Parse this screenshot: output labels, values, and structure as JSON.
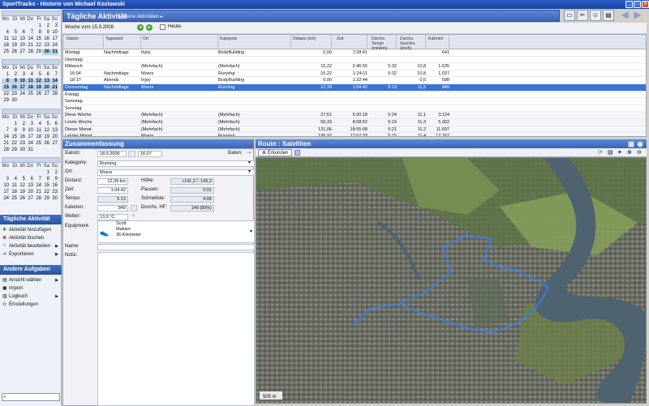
{
  "window": {
    "title": "SportTracks - Historie von Michael Kozlowski"
  },
  "calendar": {
    "weekdays": [
      "Mo",
      "Di",
      "Mi",
      "Do",
      "Fr",
      "Sa",
      "So"
    ],
    "months": [
      {
        "days": [
          "",
          "",
          "",
          "",
          "1",
          "2",
          "3",
          "4",
          "5",
          "6",
          "7",
          "8",
          "9",
          "10",
          "11",
          "12",
          "13",
          "14",
          "15",
          "16",
          "17",
          "18",
          "19",
          "20",
          "21",
          "22",
          "23",
          "24",
          "25",
          "26",
          "27",
          "28",
          "29",
          "30",
          "31"
        ]
      },
      {
        "days": [
          "1",
          "2",
          "3",
          "4",
          "5",
          "6",
          "7",
          "8",
          "9",
          "10",
          "11",
          "12",
          "13",
          "14",
          "15",
          "16",
          "17",
          "18",
          "19",
          "20",
          "21",
          "22",
          "23",
          "24",
          "25",
          "26",
          "27",
          "28",
          "29",
          "30"
        ]
      },
      {
        "days": [
          "",
          "1",
          "2",
          "3",
          "4",
          "5",
          "6",
          "7",
          "8",
          "9",
          "10",
          "11",
          "12",
          "13",
          "14",
          "15",
          "16",
          "17",
          "18",
          "19",
          "20",
          "21",
          "22",
          "23",
          "24",
          "25",
          "26",
          "27",
          "28",
          "29",
          "30",
          "31"
        ]
      },
      {
        "days": [
          "",
          "",
          "",
          "",
          "",
          "1",
          "2",
          "3",
          "4",
          "5",
          "6",
          "7",
          "8",
          "9",
          "10",
          "11",
          "12",
          "13",
          "14",
          "15",
          "16",
          "17",
          "18",
          "19",
          "20",
          "21",
          "22",
          "23",
          "24",
          "25",
          "26",
          "27",
          "28",
          "29",
          "30"
        ]
      }
    ]
  },
  "left_tasks": {
    "title": "Tägliche Aktivität",
    "items": [
      "Aktivität hinzufügen",
      "Aktivität löschen",
      "Aktivität bearbeiten",
      "Exportieren"
    ]
  },
  "left_other": {
    "title": "Andere Aufgaben",
    "items": [
      "Ansicht wählen",
      "Import",
      "Logbuch",
      "Einstellungen"
    ]
  },
  "header": {
    "title": "Tägliche Aktivität",
    "crumb": "Meine Aktivitäten"
  },
  "week": {
    "label": "Woche vom 15.9.2008",
    "today": "Heute"
  },
  "table": {
    "columns": [
      "Datum",
      "Tageszeit",
      "Ort",
      "Kategorie",
      "Distanz (km)",
      "Zeit",
      "Durchs. Tempo (min/km)",
      "Durchs. Geschw. (km/h)",
      "Kalorien"
    ],
    "rows": [
      {
        "c": [
          "Montag",
          "Nachmittags",
          "Injoy",
          "BodyBuilding",
          "0,00",
          "1:28:41",
          "",
          "",
          "641"
        ]
      },
      {
        "c": [
          "Dienstag",
          "",
          "",
          "",
          "",
          "",
          "",
          "",
          ""
        ]
      },
      {
        "c": [
          "Mittwoch",
          "",
          "(Mehrfach)",
          "(Mehrfach)",
          "15,22",
          "2:46:55",
          "5:32",
          "10,8",
          "1.635"
        ]
      },
      {
        "c": [
          "16:04",
          "Nachmittags",
          "Moers",
          "Running",
          "15,22",
          "1:24:11",
          "5:32",
          "10,8",
          "1.037"
        ]
      },
      {
        "c": [
          "18:17",
          "Abends",
          "Injoy",
          "BodyBuilding",
          "0,00",
          "1:22:44",
          "",
          "0,0",
          "598"
        ]
      },
      {
        "c": [
          "Donnerstag",
          "Nachmittags",
          "Moers",
          "Running",
          "12,39",
          "1:04:42",
          "5:13",
          "11,5",
          "849"
        ],
        "sel": true
      },
      {
        "c": [
          "Freitag",
          "",
          "",
          "",
          "",
          "",
          "",
          "",
          ""
        ]
      },
      {
        "c": [
          "Samstag",
          "",
          "",
          "",
          "",
          "",
          "",
          "",
          ""
        ]
      },
      {
        "c": [
          "Sonntag",
          "",
          "",
          "",
          "",
          "",
          "",
          "",
          ""
        ]
      },
      {
        "c": [
          "Diese Woche",
          "",
          "(Mehrfach)",
          "(Mehrfach)",
          "27,61",
          "5:20:18",
          "5:24",
          "11,1",
          "3.124"
        ],
        "sum": true
      },
      {
        "c": [
          "Letzte Woche",
          "",
          "(Mehrfach)",
          "(Mehrfach)",
          "59,33",
          "8:08:52",
          "5:19",
          "11,3",
          "5.302"
        ],
        "sum": true
      },
      {
        "c": [
          "Dieser Monat",
          "",
          "(Mehrfach)",
          "(Mehrfach)",
          "131,06",
          "18:55:08",
          "5:21",
          "11,2",
          "11.697"
        ],
        "sum": true
      },
      {
        "c": [
          "Letzter Monat",
          "",
          "Moers",
          "Running",
          "195,92",
          "17:07:33",
          "5:15",
          "11,4",
          "12.767"
        ],
        "sum": true
      }
    ]
  },
  "summary": {
    "title": "Zusammenfassung",
    "datum_label": "Datum:",
    "datum": "18.9.2008",
    "time": "16:07",
    "daten_label": "Daten:",
    "kategorie_label": "Kategorie:",
    "kategorie": "Running",
    "ort_label": "Ort:",
    "ort": "Moers",
    "distanz_label": "Distanz:",
    "distanz": "12,39 km",
    "hoehe_label": "Höhe:",
    "hoehe": "+141,2 / -145,2",
    "zeit_label": "Zeit:",
    "zeit": "1:04:42",
    "pausen_label": "Pausen:",
    "pausen": "0:01",
    "tempo_label": "Tempo:",
    "tempo": "5:13",
    "schnell_label": "Schnellste:",
    "schnell": "4:08",
    "kalorien_label": "Kalorien:",
    "kalorien": "849",
    "hf_label": "Durchs. HF:",
    "hf": "148 (80%)",
    "wetter_label": "Wetter:",
    "wetter": "13,9 °C",
    "equipment_label": "Equipment:",
    "equip_brand": "Scott",
    "equip_model": "Makani",
    "equip_km": "36 Kilometer",
    "name_label": "Name:",
    "notiz_label": "Notiz:"
  },
  "map": {
    "title": "Route : Satelliten",
    "tab": "Erkunden",
    "scale": "500 m"
  }
}
